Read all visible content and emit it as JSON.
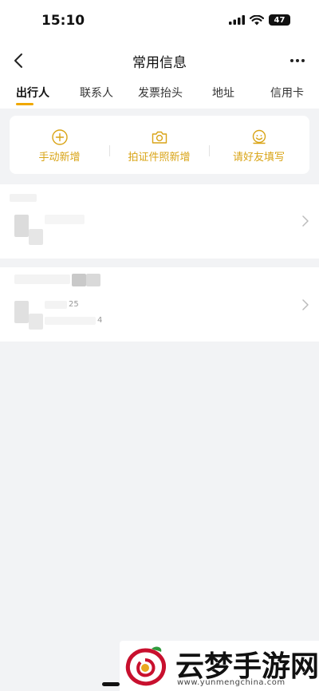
{
  "status_bar": {
    "time": "15:10",
    "battery": "47"
  },
  "nav": {
    "title": "常用信息"
  },
  "tabs": [
    "出行人",
    "联系人",
    "发票抬头",
    "地址",
    "信用卡"
  ],
  "actions": [
    {
      "label": "手动新增",
      "icon": "plus-circle-icon"
    },
    {
      "label": "拍证件照新增",
      "icon": "camera-icon"
    },
    {
      "label": "请好友填写",
      "icon": "friend-icon"
    }
  ],
  "colors": {
    "accent": "#f0a800",
    "action_text": "#d9a416",
    "background": "#f2f3f5"
  },
  "passengers": [
    {
      "fragment": ""
    },
    {
      "fragment_1": "25",
      "fragment_2": "4"
    }
  ],
  "watermark": {
    "title": "云梦手游网",
    "url": "www.yunmengchina.com"
  }
}
